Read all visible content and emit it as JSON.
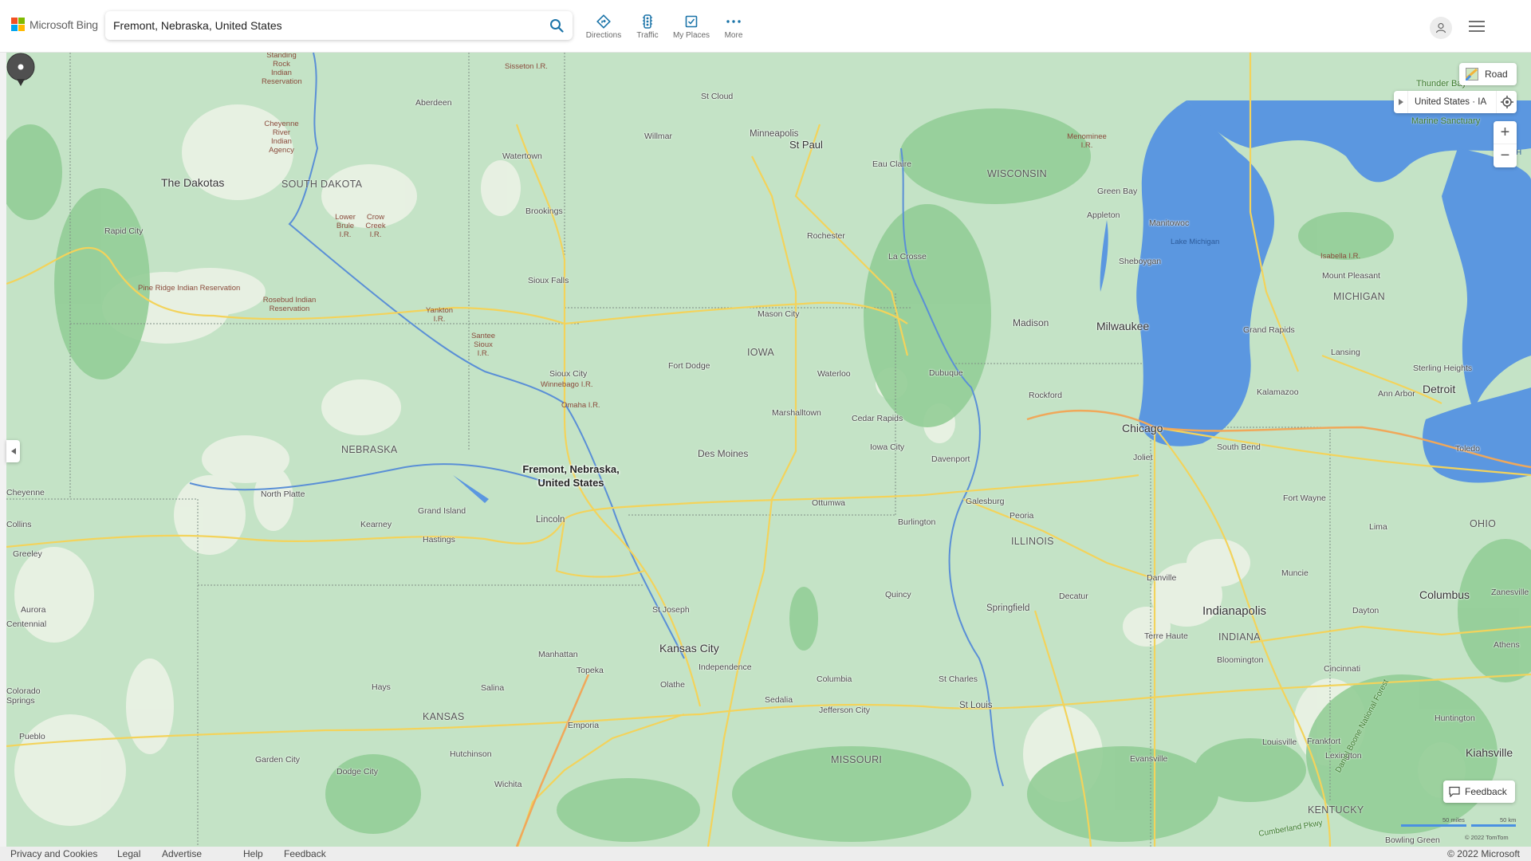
{
  "header": {
    "brand": "Microsoft Bing",
    "brand_colors": [
      "#f25022",
      "#7fba00",
      "#00a4ef",
      "#ffb900"
    ],
    "search_value": "Fremont, Nebraska, United States",
    "search_icon": "search-icon",
    "nav": [
      {
        "label": "Directions",
        "icon": "directions-icon"
      },
      {
        "label": "Traffic",
        "icon": "traffic-light-icon"
      },
      {
        "label": "My Places",
        "icon": "checkbox-icon"
      },
      {
        "label": "More",
        "icon": "more-dots-icon"
      }
    ],
    "accent_color": "#1a73a8"
  },
  "map": {
    "style_button": "Road",
    "location_breadcrumb": "United States · IA",
    "zoom_in": "+",
    "zoom_out": "−",
    "feedback_button": "Feedback",
    "scale_miles": "50 miles",
    "scale_km": "50 km",
    "tile_copyright": "© 2022 TomTom",
    "pin": {
      "line1": "Fremont, Nebraska,",
      "line2": "United States"
    },
    "colors": {
      "land": "#c4e3c6",
      "forest": "#93cd97",
      "barren": "#e9f1e4",
      "water": "#5b97e0",
      "road": "#f3d35b",
      "interstate": "#f0a85a"
    },
    "states": [
      "The Dakotas",
      "SOUTH DAKOTA",
      "NEBRASKA",
      "IOWA",
      "KANSAS",
      "MISSOURI",
      "ILLINOIS",
      "WISCONSIN",
      "MICHIGAN",
      "INDIANA",
      "OHIO",
      "KENTUCKY"
    ],
    "major_cities": [
      "Minneapolis",
      "St Paul",
      "Milwaukee",
      "Chicago",
      "Des Moines",
      "Kansas City",
      "Indianapolis",
      "Detroit",
      "Columbus",
      "Kiahsville"
    ],
    "cities": [
      "Aberdeen",
      "Watertown",
      "Brookings",
      "Sioux Falls",
      "Rapid City",
      "St Cloud",
      "Willmar",
      "Eau Claire",
      "Rochester",
      "La Crosse",
      "Mason City",
      "Fort Dodge",
      "Sioux City",
      "Waterloo",
      "Dubuque",
      "Marshalltown",
      "Cedar Rapids",
      "Iowa City",
      "Davenport",
      "Rockford",
      "Madison",
      "Green Bay",
      "Appleton",
      "Manitowoc",
      "Sheboygan",
      "Grand Rapids",
      "Lansing",
      "Mount Pleasant",
      "Kalamazoo",
      "Ann Arbor",
      "Sterling Heights",
      "Toledo",
      "South Bend",
      "Fort Wayne",
      "Lima",
      "Joliet",
      "North Platte",
      "Grand Island",
      "Kearney",
      "Hastings",
      "Lincoln",
      "Ottumwa",
      "Burlington",
      "Galesburg",
      "Peoria",
      "Springfield",
      "Decatur",
      "Danville",
      "Quincy",
      "Muncie",
      "Dayton",
      "Terre Haute",
      "Bloomington",
      "Cincinnati",
      "Zanesville",
      "Athens",
      "Huntington",
      "Frankfort",
      "Lexington",
      "Louisville",
      "Evansville",
      "St Charles",
      "St Louis",
      "Columbia",
      "Jefferson City",
      "Sedalia",
      "Independence",
      "Olathe",
      "Topeka",
      "Manhattan",
      "Salina",
      "Hays",
      "Emporia",
      "Hutchinson",
      "Wichita",
      "Garden City",
      "Dodge City",
      "St Joseph",
      "Cheyenne",
      "Collins",
      "Greeley",
      "Aurora",
      "Centennial",
      "Colorado Springs",
      "Pueblo",
      "Bowling Green"
    ],
    "reservations": [
      "Standing Rock Indian Reservation",
      "Cheyenne River Indian Agency",
      "Sisseton I.R.",
      "Lower Brule I.R.",
      "Crow Creek I.R.",
      "Pine Ridge Indian Reservation",
      "Rosebud Indian Reservation",
      "Yankton I.R.",
      "Santee Sioux I.R.",
      "Winnebago I.R.",
      "Omaha I.R.",
      "Menominee I.R.",
      "Isabella I.R."
    ],
    "water_labels": [
      "Lake Michigan",
      "Lake H"
    ],
    "park_labels": [
      "Thunder Bay",
      "Marine Sanctuary",
      "Daniel Boone National Forest",
      "Cumberland Pkwy"
    ]
  },
  "footer": {
    "links": [
      "Privacy and Cookies",
      "Legal",
      "Advertise",
      "Help",
      "Feedback"
    ],
    "copyright": "© 2022 Microsoft"
  }
}
